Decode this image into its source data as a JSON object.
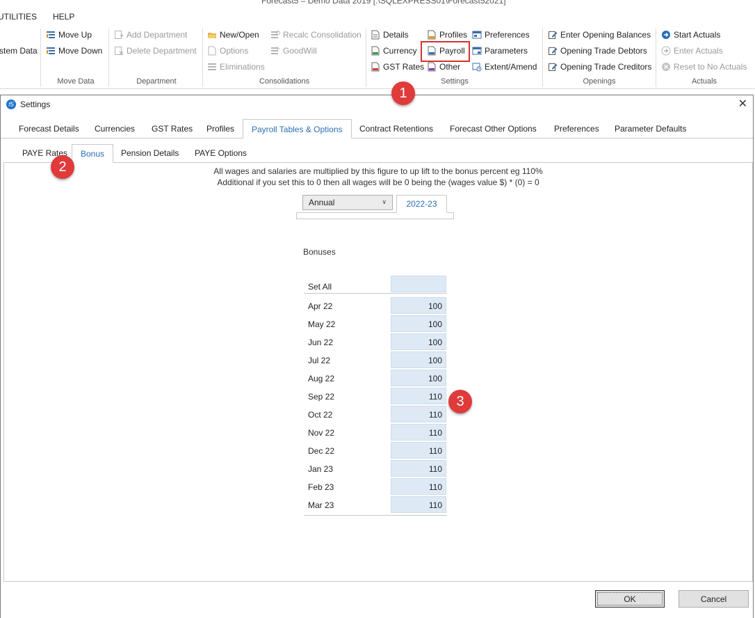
{
  "window": {
    "title": "Forecast5 – Demo Data 2019 [.\\SQLEXPRESS01\\Forecast52021]"
  },
  "menu": [
    "UTILITIES",
    "HELP"
  ],
  "ribbon": {
    "system_data_label": "stem Data",
    "move": {
      "up": "Move Up",
      "down": "Move Down",
      "group": "Move Data"
    },
    "department": {
      "add": "Add Department",
      "delete": "Delete Department",
      "group": "Department"
    },
    "consolidations": {
      "new_open": "New/Open",
      "options": "Options",
      "eliminations": "Eliminations",
      "recalc": "Recalc Consolidation",
      "goodwill": "GoodWill",
      "group": "Consolidations"
    },
    "settings": {
      "details": "Details",
      "currency": "Currency",
      "gst_rates": "GST Rates",
      "profiles": "Profiles",
      "payroll": "Payroll",
      "other": "Other",
      "preferences": "Preferences",
      "parameters": "Parameters",
      "extent": "Extent/Amend",
      "group": "Settings"
    },
    "openings": {
      "balances": "Enter Opening Balances",
      "debtors": "Opening Trade Debtors",
      "creditors": "Opening Trade Creditors",
      "group": "Openings"
    },
    "actuals": {
      "start": "Start Actuals",
      "enter": "Enter Actuals",
      "reset": "Reset to No Actuals",
      "group": "Actuals"
    }
  },
  "callouts": [
    "1",
    "2",
    "3"
  ],
  "dialog": {
    "title": "Settings",
    "close": "✕",
    "tabs": [
      "Forecast Details",
      "Currencies",
      "GST Rates",
      "Profiles",
      "Payroll Tables & Options",
      "Contract Retentions",
      "Forecast Other Options",
      "Preferences",
      "Parameter Defaults"
    ],
    "subtabs": [
      "PAYE Rates",
      "Bonus",
      "Pension Details",
      "PAYE Options"
    ],
    "info_line1": "All wages and salaries are multiplied by this figure to up lift to the bonus percent eg 110%",
    "info_line2": "Additional if you set this to 0 then all wages will be 0 being the (wages value $) * (0) = 0",
    "period_select": "Annual",
    "year_tab": "2022-23",
    "bonuses_label": "Bonuses",
    "set_all_label": "Set All",
    "set_all_value": "",
    "rows": [
      {
        "month": "Apr 22",
        "value": "100"
      },
      {
        "month": "May 22",
        "value": "100"
      },
      {
        "month": "Jun 22",
        "value": "100"
      },
      {
        "month": "Jul 22",
        "value": "100"
      },
      {
        "month": "Aug 22",
        "value": "100"
      },
      {
        "month": "Sep 22",
        "value": "110"
      },
      {
        "month": "Oct 22",
        "value": "110"
      },
      {
        "month": "Nov 22",
        "value": "110"
      },
      {
        "month": "Dec 22",
        "value": "110"
      },
      {
        "month": "Jan 23",
        "value": "110"
      },
      {
        "month": "Feb 23",
        "value": "110"
      },
      {
        "month": "Mar 23",
        "value": "110"
      }
    ],
    "ok": "OK",
    "cancel": "Cancel"
  },
  "colors": {
    "accent": "#2a6fb4",
    "callout": "#e03a3a",
    "cell": "#dde9f5"
  }
}
